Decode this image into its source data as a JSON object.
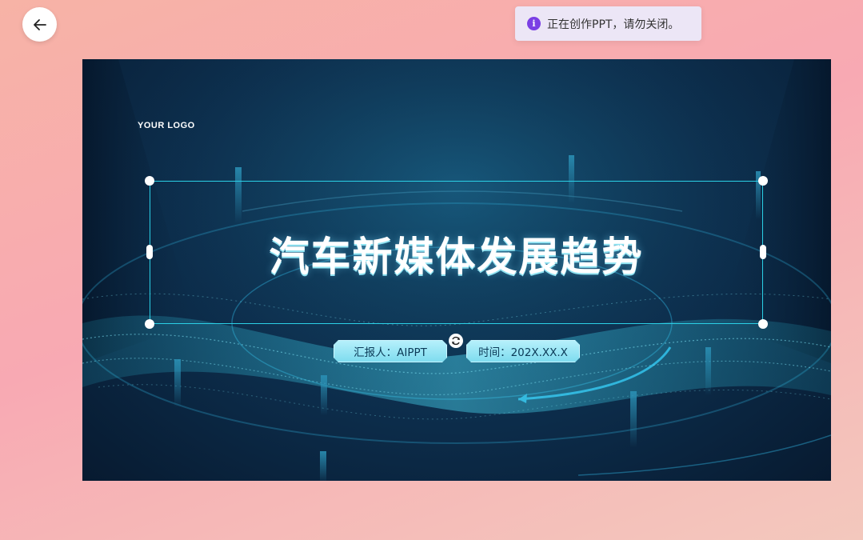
{
  "toast": {
    "icon": "info-icon",
    "message": "正在创作PPT，请勿关闭。",
    "accent_color": "#7b3fe4"
  },
  "nav": {
    "back_icon": "arrow-left-icon"
  },
  "slide": {
    "logo_text": "YOUR LOGO",
    "title": "汽车新媒体发展趋势",
    "reporter": "汇报人：AIPPT",
    "time": "时间：202X.XX.X",
    "selection_color": "#2bd0e6"
  }
}
